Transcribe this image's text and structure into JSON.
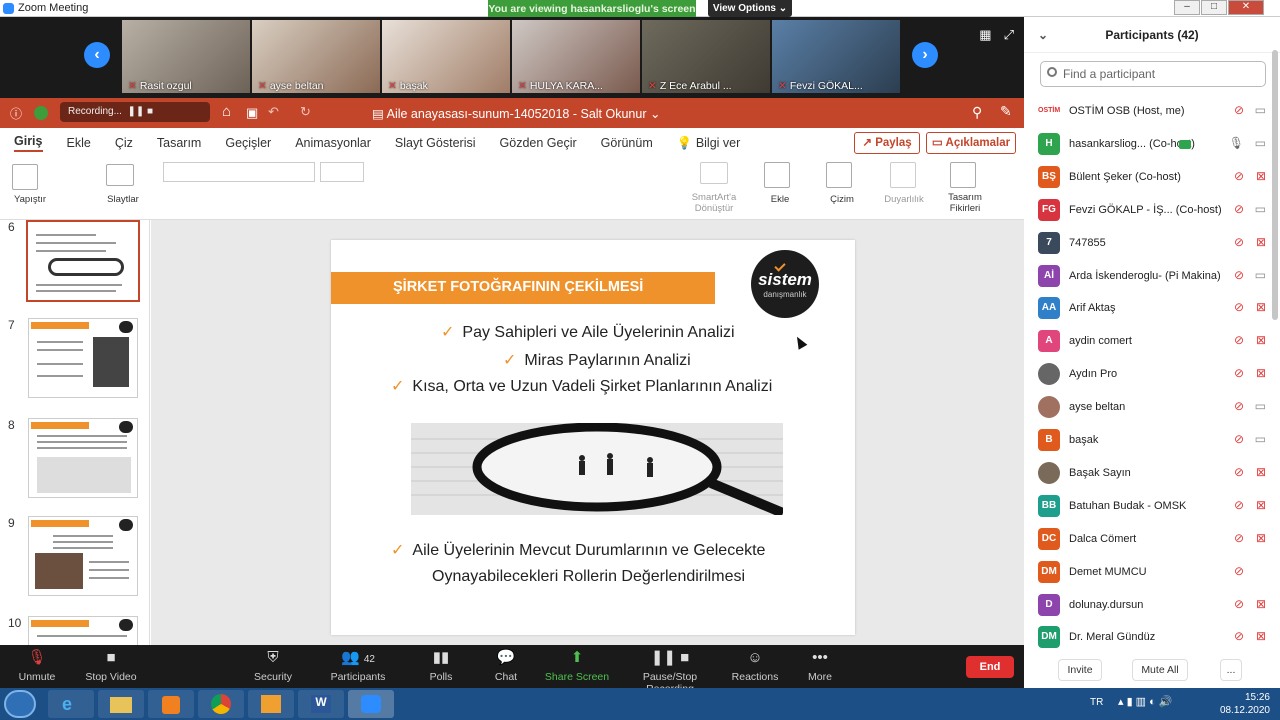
{
  "window": {
    "title": "Zoom Meeting",
    "banner": "You are viewing hasankarslioglu's screen",
    "view_options": "View Options"
  },
  "video_tiles": [
    {
      "name": "Rasit ozgul"
    },
    {
      "name": "ayse beltan"
    },
    {
      "name": "başak"
    },
    {
      "name": "HULYA KARA..."
    },
    {
      "name": "Z Ece Arabul ..."
    },
    {
      "name": "Fevzi GÖKAL..."
    }
  ],
  "ppt": {
    "recording": "Recording...",
    "doc_title": "Aile anayasası-sunum-14052018  -  Salt Okunur",
    "tabs": [
      "Giriş",
      "Ekle",
      "Çiz",
      "Tasarım",
      "Geçişler",
      "Animasyonlar",
      "Slayt Gösterisi",
      "Gözden Geçir",
      "Görünüm",
      "Bilgi ver"
    ],
    "share": "Paylaş",
    "comments": "Açıklamalar",
    "ribbon": {
      "paste": "Yapıştır",
      "slides": "Slaytlar",
      "smartart": "SmartArt'a Dönüştür",
      "insert": "Ekle",
      "draw": "Çizim",
      "sensitivity": "Duyarlılık",
      "designer": "Tasarım Fikirleri"
    },
    "thumb_numbers": [
      "6",
      "7",
      "8",
      "9",
      "10"
    ],
    "slide": {
      "header": "ŞİRKET FOTOĞRAFININ ÇEKİLMESİ",
      "logo_main": "sistem",
      "logo_sub": "danışmanlık",
      "bullet1": "Pay Sahipleri ve Aile Üyelerinin Analizi",
      "bullet2": "Miras Paylarının Analizi",
      "bullet3": "Kısa, Orta ve Uzun Vadeli Şirket Planlarının Analizi",
      "bullet4a": "Aile Üyelerinin Mevcut Durumlarının ve Gelecekte",
      "bullet4b": "Oynayabilecekleri Rollerin Değerlendirilmesi"
    }
  },
  "controls": {
    "unmute": "Unmute",
    "stop_video": "Stop Video",
    "security": "Security",
    "participants": "Participants",
    "participants_count": "42",
    "polls": "Polls",
    "chat": "Chat",
    "share_screen": "Share Screen",
    "pause_record": "Pause/Stop Recording",
    "reactions": "Reactions",
    "more": "More",
    "end": "End"
  },
  "panel": {
    "title": "Participants (42)",
    "search_placeholder": "Find a participant",
    "invite": "Invite",
    "mute_all": "Mute All",
    "more": "..."
  },
  "participants": [
    {
      "initials": "",
      "name": "OSTİM OSB (Host, me)",
      "color": "#ffffff",
      "video": true
    },
    {
      "initials": "H",
      "name": "hasankarsliog... (Co-host)",
      "color": "#2ea44f",
      "video": true
    },
    {
      "initials": "BŞ",
      "name": "Bülent Şeker (Co-host)",
      "color": "#e05a1e",
      "video": false
    },
    {
      "initials": "FG",
      "name": "Fevzi GÖKALP - İŞ... (Co-host)",
      "color": "#d8343f",
      "video": true
    },
    {
      "initials": "7",
      "name": "747855",
      "color": "#3a4a5c",
      "video": false
    },
    {
      "initials": "Aİ",
      "name": "Arda İskenderoglu- (Pi Makina)",
      "color": "#8e44ad",
      "video": true
    },
    {
      "initials": "AA",
      "name": "Arif Aktaş",
      "color": "#2f80c8",
      "video": false
    },
    {
      "initials": "A",
      "name": "aydin comert",
      "color": "#e0457b",
      "video": false
    },
    {
      "initials": "",
      "name": "Aydın Pro",
      "color": "#666666",
      "video": false
    },
    {
      "initials": "",
      "name": "ayse beltan",
      "color": "#a07060",
      "video": true
    },
    {
      "initials": "B",
      "name": "başak",
      "color": "#e05a1e",
      "video": true
    },
    {
      "initials": "",
      "name": "Başak Sayın",
      "color": "#7a6a5a",
      "video": false
    },
    {
      "initials": "BB",
      "name": "Batuhan Budak - OMSK",
      "color": "#1e9e8c",
      "video": false
    },
    {
      "initials": "DC",
      "name": "Dalca Cömert",
      "color": "#e05a1e",
      "video": false
    },
    {
      "initials": "DM",
      "name": "Demet MUMCU",
      "color": "#e05a1e",
      "video": false
    },
    {
      "initials": "D",
      "name": "dolunay.dursun",
      "color": "#8e44ad",
      "video": false
    },
    {
      "initials": "DM",
      "name": "Dr. Meral Gündüz",
      "color": "#1e9e6c",
      "video": false
    }
  ],
  "taskbar": {
    "lang": "TR",
    "time": "15:26",
    "date": "08.12.2020"
  }
}
